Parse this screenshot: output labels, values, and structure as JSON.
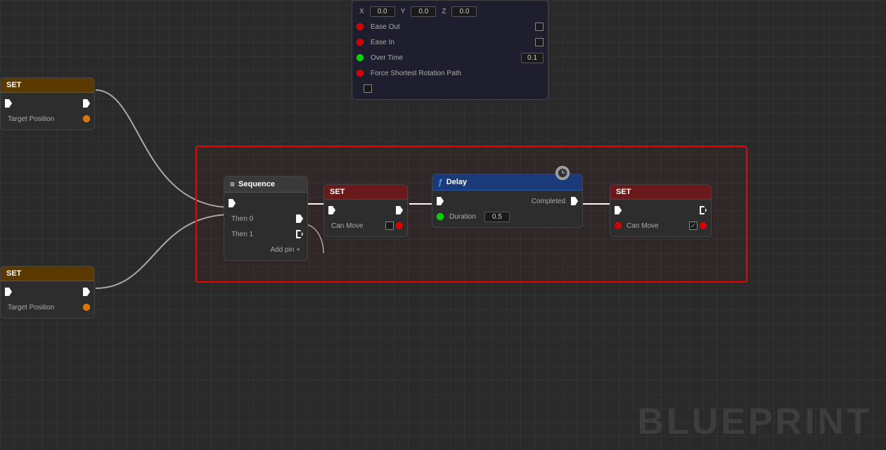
{
  "canvas": {
    "background": "#2a2a2a",
    "grid_color": "rgba(255,255,255,0.04)"
  },
  "watermark": "BLUEPRINT",
  "nodes": {
    "sequence": {
      "title": "Sequence",
      "icon": "≡",
      "then0": "Then 0",
      "then1": "Then 1",
      "add_pin": "Add pin +"
    },
    "set1": {
      "title": "SET",
      "can_move": "Can Move",
      "checkbox_value": false
    },
    "delay": {
      "title": "Delay",
      "duration_label": "Duration",
      "duration_value": "0.5",
      "completed": "Completed"
    },
    "set2": {
      "title": "SET",
      "can_move": "Can Move",
      "checkbox_value": true
    },
    "set_left1": {
      "title": "SET",
      "target_position": "Target Position"
    },
    "set_left2": {
      "title": "SET",
      "target_position": "Target Position"
    },
    "top_right": {
      "x_label": "X",
      "y_label": "Y",
      "z_label": "Z",
      "x_value": "0.0",
      "y_value": "0.0",
      "z_value": "0.0",
      "ease_out": "Ease Out",
      "ease_in": "Ease In",
      "over_time": "Over Time",
      "over_time_value": "0.1",
      "force_shortest": "Force Shortest Rotation Path"
    }
  }
}
